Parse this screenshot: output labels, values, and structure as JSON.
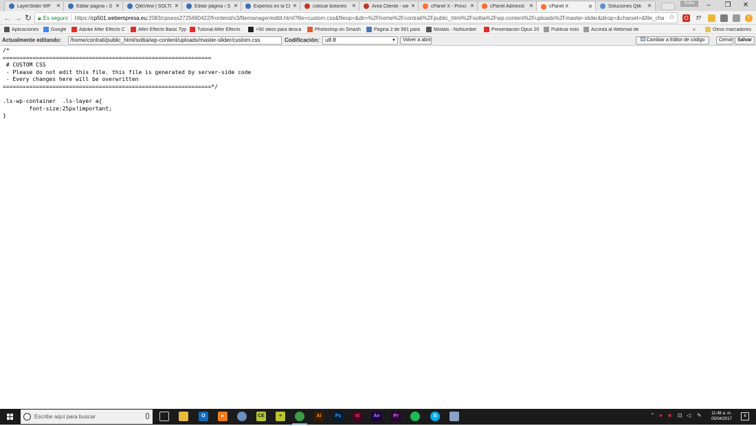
{
  "browser": {
    "tabs": [
      {
        "title": "LayerSlider WP",
        "icon_color": "#3b6fb6"
      },
      {
        "title": "Editar página ‹ S",
        "icon_color": "#3b6fb6"
      },
      {
        "title": "QlikView | SOLTI",
        "icon_color": "#3b6fb6"
      },
      {
        "title": "Editar página ‹ S",
        "icon_color": "#3b6fb6"
      },
      {
        "title": "Expertos en la Cl",
        "icon_color": "#3b6fb6"
      },
      {
        "title": "colocar botones",
        "icon_color": "#c0392b"
      },
      {
        "title": "Área Cliente - we",
        "icon_color": "#c0392b"
      },
      {
        "title": "cPanel X - Princi",
        "icon_color": "#ff6c2c"
      },
      {
        "title": "cPanel Administ",
        "icon_color": "#ff6c2c"
      },
      {
        "title": "cPanel X",
        "icon_color": "#ff6c2c"
      },
      {
        "title": "Soluciones Qlik",
        "icon_color": "#5a8fd0"
      }
    ],
    "user_badge": "Soltia",
    "window_controls": {
      "minimize": "–",
      "restore": "❐",
      "close": "✕"
    },
    "secure_label": "Es seguro",
    "url_scheme": "https://",
    "url_host": "cp501.webempresa.eu",
    "url_rest": ":2083/cpsess2725690422/frontend/x3/filemanager/editit.html?file=custom.css&fileop=&dir=%2Fhome%2Fcontrati%2Fpublic_html%2Fsoltia%2Fwp-content%2Fuploads%2Fmaster-slider&dirop=&charset=&file_cha",
    "bookmarks": [
      {
        "label": "Aplicaciones",
        "icon_color": "#555555"
      },
      {
        "label": "Google",
        "icon_color": "#4285f4"
      },
      {
        "label": "Adobe After Effects C",
        "icon_color": "#e52d27"
      },
      {
        "label": "After Effects Basic Typ",
        "icon_color": "#e52d27"
      },
      {
        "label": "Tutorial After Effects",
        "icon_color": "#e52d27"
      },
      {
        "label": "+50 sitios para desca",
        "icon_color": "#222222"
      },
      {
        "label": "Photoshop on Smash",
        "icon_color": "#e8592c"
      },
      {
        "label": "Página 2 de 991 para",
        "icon_color": "#4a76b8"
      },
      {
        "label": "Modals - NoNumber",
        "icon_color": "#555555"
      },
      {
        "label": "Presentación Opus 20",
        "icon_color": "#e52d27"
      },
      {
        "label": "Publicar esto",
        "icon_color": "#999999"
      },
      {
        "label": "Acceda al Webmail de",
        "icon_color": "#999999"
      }
    ],
    "bookmarks_more": "»",
    "other_bookmarks": "Otros marcadores"
  },
  "editor": {
    "editing_label": "Actualmente editando:",
    "path": "/home/contrati/public_html/soltia/wp-content/uploads/master-slider/custom.css",
    "encoding_label": "Codificación:",
    "encoding_value": "utf-8",
    "reopen_button": "Volver a abrir",
    "switch_editor_button": "Cambiar a Editor de código",
    "close_button": "Cerrar",
    "save_button": "Salvar"
  },
  "code_lines": [
    "/*",
    "===============================================================",
    " # CUSTOM CSS",
    " - Please do not edit this file. this file is generated by server-side code",
    " - Every changes here will be overwritten",
    "===============================================================*/",
    "",
    ".ls-wp-container  .ls-layer a{",
    "        font-size:25px!important;",
    "}"
  ],
  "taskbar": {
    "search_placeholder": "Escribe aquí para buscar",
    "clock_time": "11:48 a. m.",
    "clock_date": "05/04/2017",
    "notification_count": "6"
  }
}
